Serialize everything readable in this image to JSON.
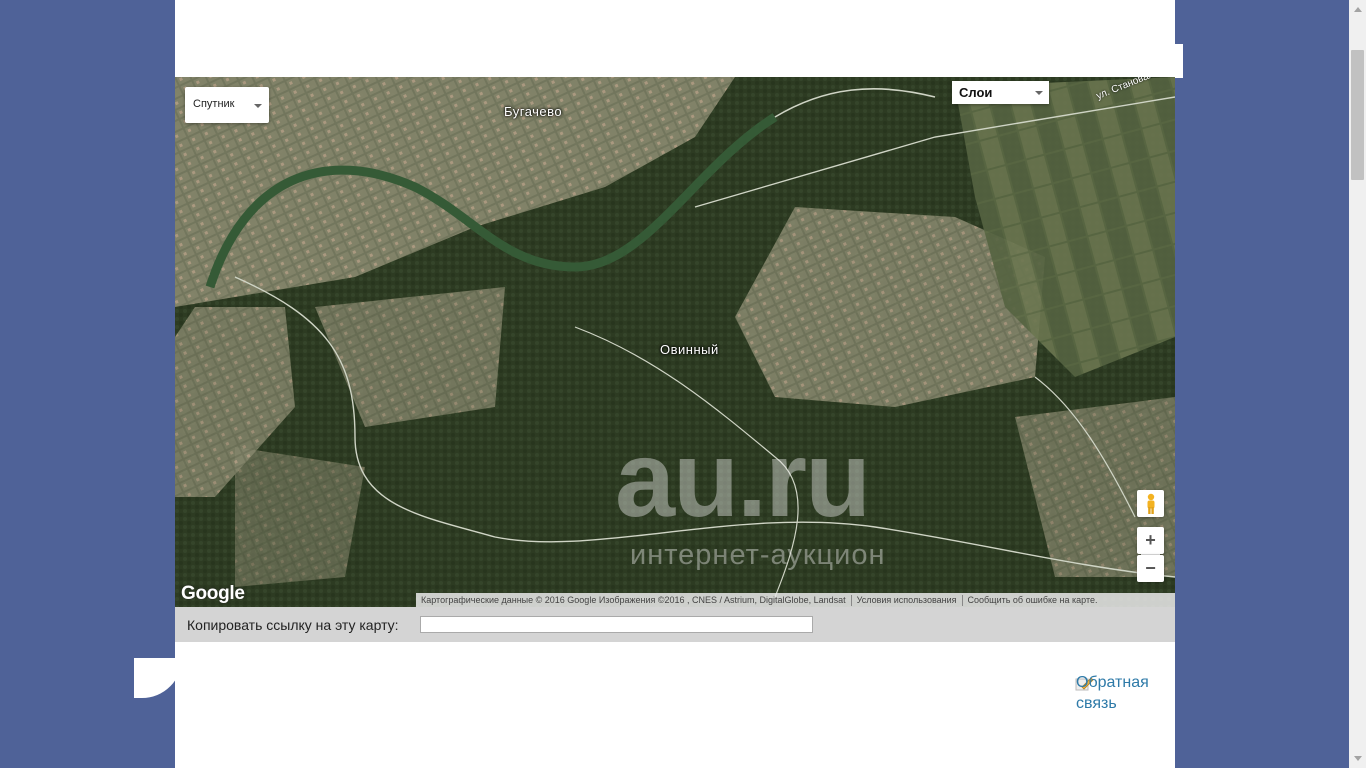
{
  "map": {
    "type_selector": "Спутник",
    "layers_selector": "Слои",
    "places": {
      "village_1": "Бугачево",
      "village_2": "Овинный"
    },
    "street": "ул. Становая",
    "watermark": {
      "brand": "au.ru",
      "tagline": "интернет-аукцион"
    },
    "logo": "Google",
    "attribution": {
      "data": "Картографические данные © 2016 Google Изображения ©2016 , CNES / Astrium, DigitalGlobe, Landsat",
      "terms": "Условия использования",
      "report": "Сообщить об ошибке на карте."
    },
    "zoom_in": "+",
    "zoom_out": "−"
  },
  "copy_link": {
    "label": "Копировать ссылку на эту карту:",
    "value": ""
  },
  "feedback": {
    "line1": "Обратная",
    "line2": "связь"
  },
  "colors": {
    "background": "#4f6298",
    "link": "#2e7aa8",
    "copybar": "#d4d4d4"
  },
  "icons": {
    "pegman": "pegman-icon",
    "zoom_in": "plus-icon",
    "zoom_out": "minus-icon",
    "feedback": "pencil-note-icon"
  }
}
